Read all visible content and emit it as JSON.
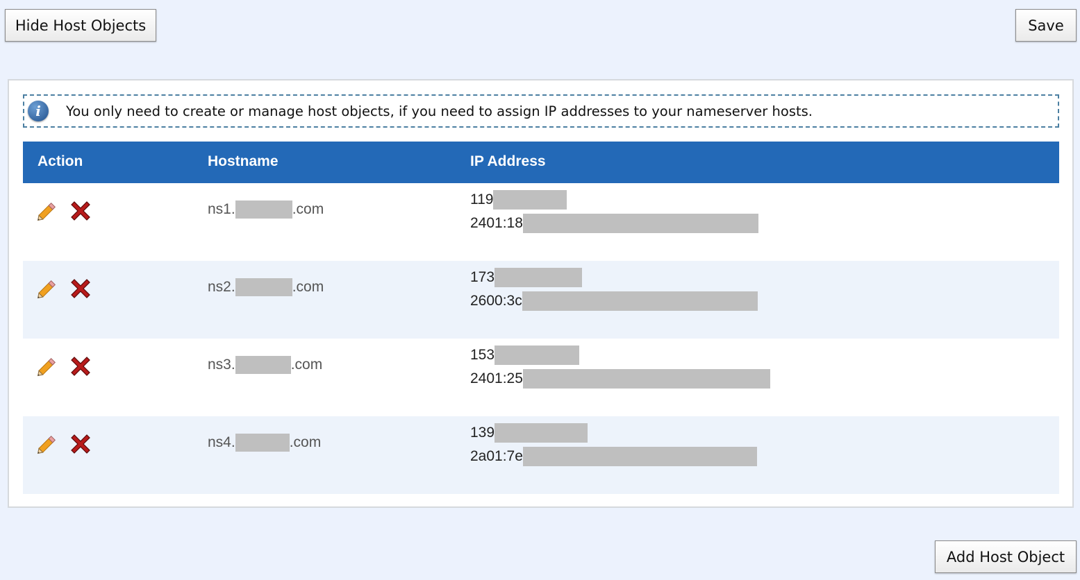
{
  "toolbar": {
    "hide_label": "Hide Host Objects",
    "save_label": "Save",
    "add_label": "Add Host Object"
  },
  "notice": {
    "icon": "info-icon",
    "text": "You only need to create or manage host objects, if you need to assign IP addresses to your nameserver hosts."
  },
  "table": {
    "headers": {
      "action": "Action",
      "hostname": "Hostname",
      "ip": "IP Address"
    },
    "rows": [
      {
        "host_prefix": "ns1.",
        "host_suffix": ".com",
        "ipv4": "119",
        "ipv6": "2401:18"
      },
      {
        "host_prefix": "ns2.",
        "host_suffix": ".com",
        "ipv4": "173",
        "ipv6": "2600:3c"
      },
      {
        "host_prefix": "ns3.",
        "host_suffix": ".com",
        "ipv4": "153",
        "ipv6": "2401:25"
      },
      {
        "host_prefix": "ns4.",
        "host_suffix": ".com",
        "ipv4": "139",
        "ipv6": "2a01:7e"
      }
    ]
  },
  "colors": {
    "page_bg": "#ecf2fd",
    "header_bg": "#2369b7",
    "alt_row_bg": "#edf3fb",
    "redaction": "#bfbfbf",
    "delete_red": "#b81b1b",
    "pencil_orange": "#f0a020"
  }
}
